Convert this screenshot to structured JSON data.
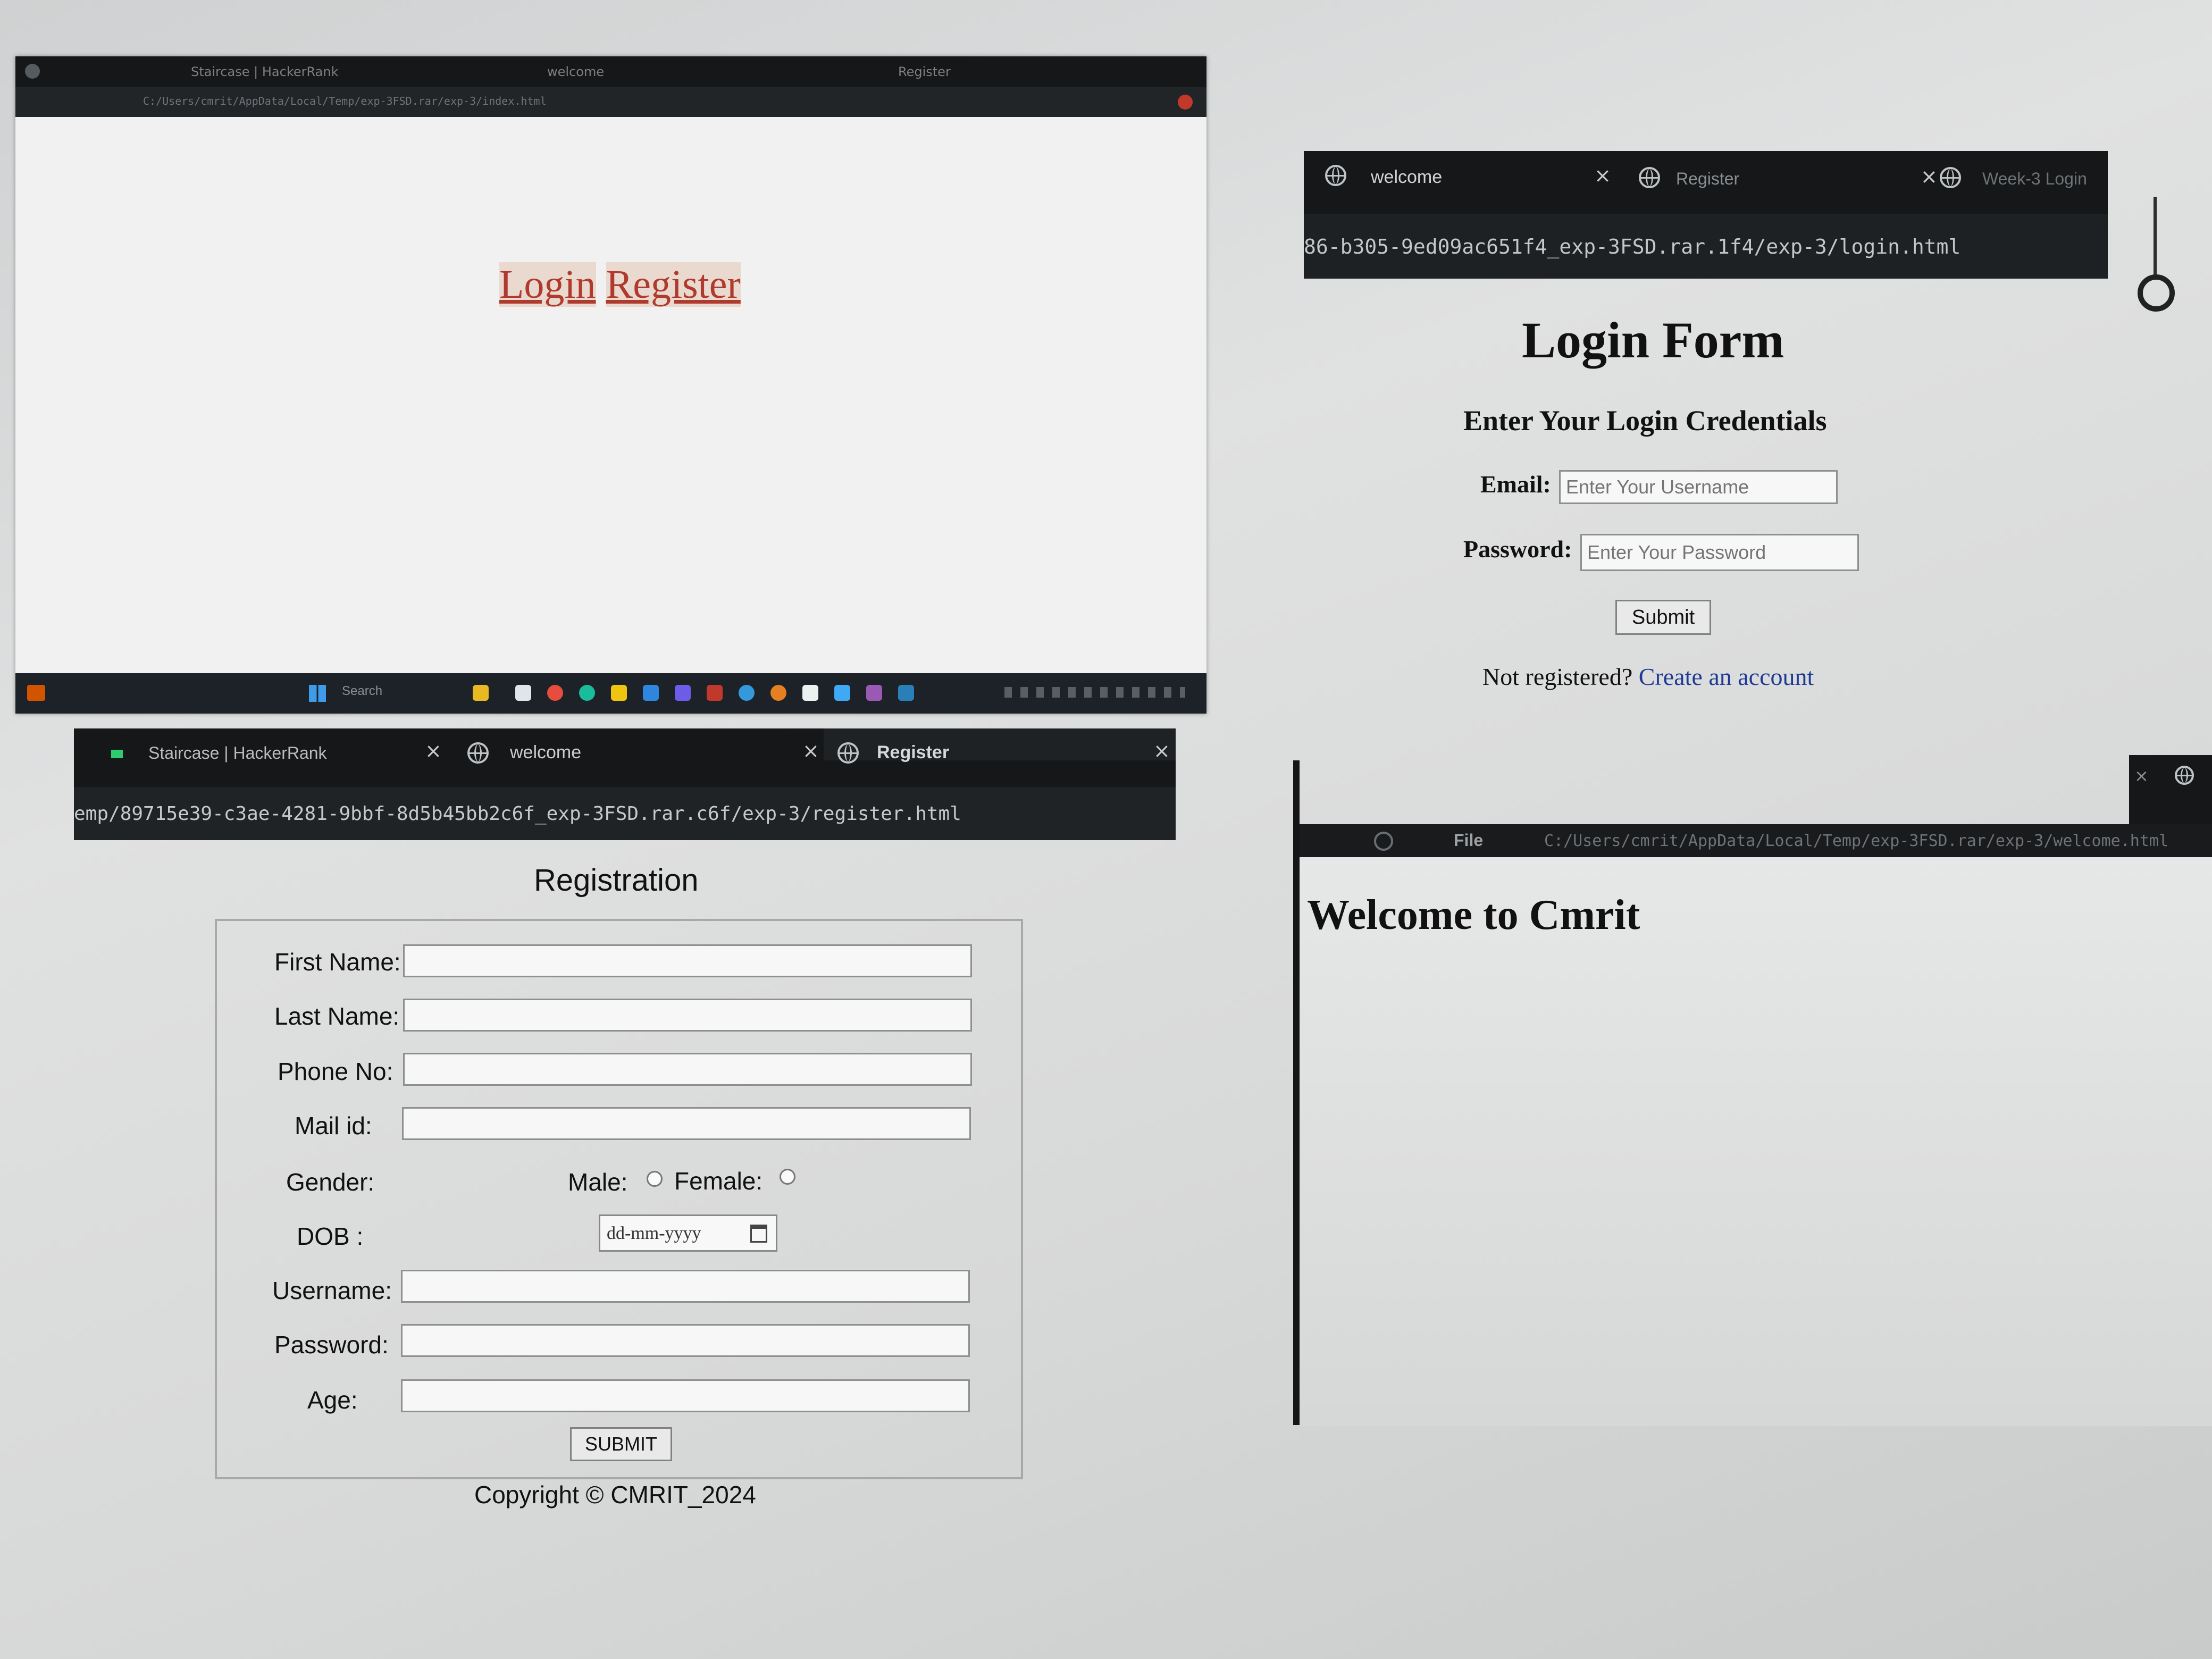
{
  "top_left_window": {
    "tabs": [
      "Staircase | HackerRank",
      "welcome",
      "Register"
    ],
    "address": "C:/Users/cmrit/AppData/Local/Temp/exp-3FSD.rar/exp-3/index.html",
    "links": {
      "login": "Login",
      "register": "Register"
    },
    "taskbar": {
      "search": "Search"
    }
  },
  "login_window": {
    "tabs": [
      "welcome",
      "Register",
      "Week-3 Login"
    ],
    "address": "86-b305-9ed09ac651f4_exp-3FSD.rar.1f4/exp-3/login.html",
    "title": "Login Form",
    "subtitle": "Enter Your Login Credentials",
    "email_label": "Email:",
    "email_placeholder": "Enter Your Username",
    "password_label": "Password:",
    "password_placeholder": "Enter Your Password",
    "submit": "Submit",
    "not_registered": "Not registered?",
    "create_account": "Create an account"
  },
  "register_window": {
    "tabs": [
      "Staircase | HackerRank",
      "welcome",
      "Register"
    ],
    "address": "emp/89715e39-c3ae-4281-9bbf-8d5b45bb2c6f_exp-3FSD.rar.c6f/exp-3/register.html",
    "title": "Registration",
    "labels": {
      "first_name": "First Name:",
      "last_name": "Last Name:",
      "phone": "Phone No:",
      "mail": "Mail id:",
      "gender": "Gender:",
      "male": "Male:",
      "female": "Female:",
      "dob": "DOB :",
      "username": "Username:",
      "password": "Password:",
      "age": "Age:"
    },
    "dob_placeholder": "dd-mm-yyyy",
    "submit": "SUBMIT",
    "copyright": "Copyright © CMRIT_2024"
  },
  "welcome_window": {
    "address_prefix": "File",
    "address": "C:/Users/cmrit/AppData/Local/Temp/exp-3FSD.rar/exp-3/welcome.html",
    "heading": "Welcome to Cmrit"
  }
}
